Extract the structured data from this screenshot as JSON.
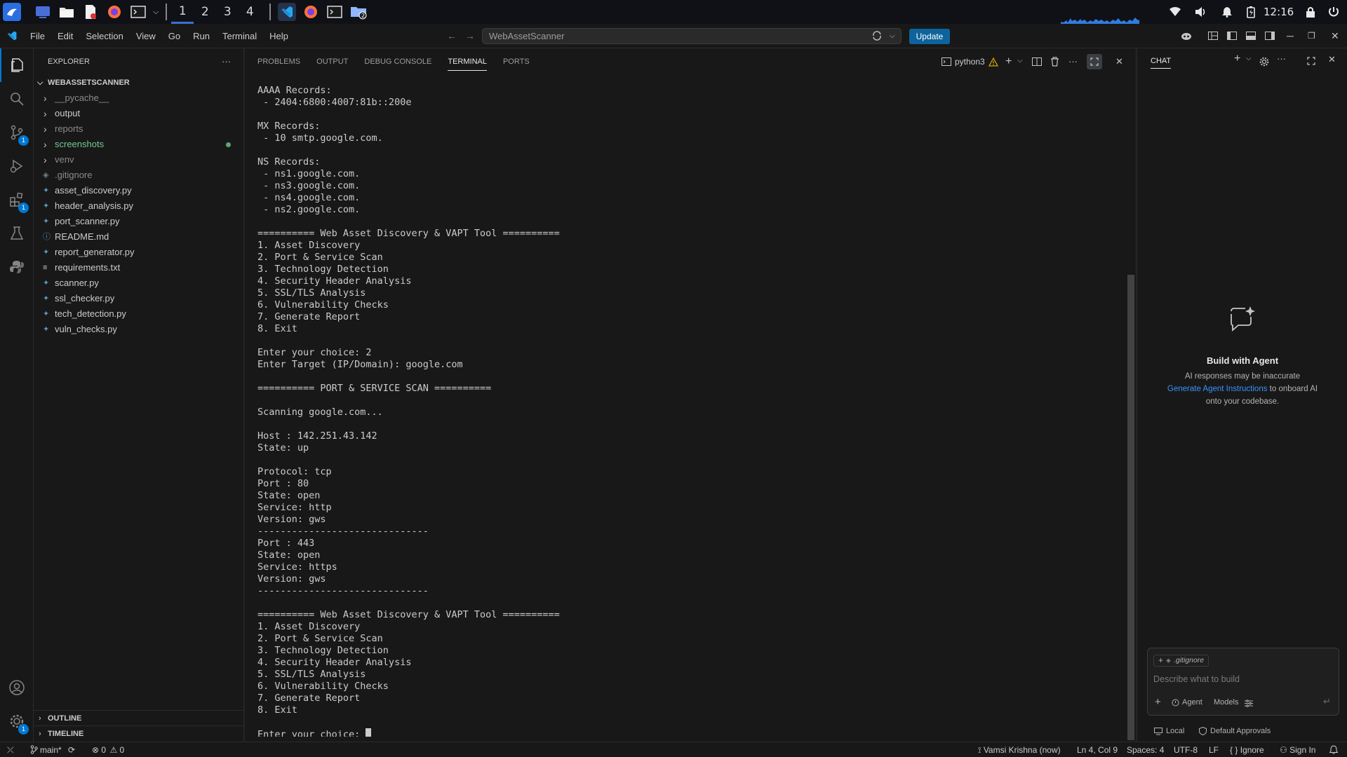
{
  "taskbar": {
    "workspaces": [
      "1",
      "2",
      "3",
      "4"
    ],
    "active_workspace": "1",
    "clock": "12:16"
  },
  "menu": [
    "File",
    "Edit",
    "Selection",
    "View",
    "Go",
    "Run",
    "Terminal",
    "Help"
  ],
  "command_center": "WebAssetScanner",
  "update_label": "Update",
  "explorer": {
    "title": "EXPLORER",
    "root": "WEBASSETSCANNER",
    "items": [
      {
        "name": "__pycache__",
        "type": "folder",
        "color": "#8b8b8b"
      },
      {
        "name": "output",
        "type": "folder",
        "color": "#cccccc"
      },
      {
        "name": "reports",
        "type": "folder",
        "color": "#8b8b8b"
      },
      {
        "name": "screenshots",
        "type": "folder",
        "color": "#73c991",
        "dot": true
      },
      {
        "name": "venv",
        "type": "folder",
        "color": "#8b8b8b"
      },
      {
        "name": ".gitignore",
        "type": "gitignore",
        "color": "#8b8b8b"
      },
      {
        "name": "asset_discovery.py",
        "type": "py",
        "color": "#cccccc"
      },
      {
        "name": "header_analysis.py",
        "type": "py",
        "color": "#cccccc"
      },
      {
        "name": "port_scanner.py",
        "type": "py",
        "color": "#cccccc"
      },
      {
        "name": "README.md",
        "type": "md",
        "color": "#cccccc"
      },
      {
        "name": "report_generator.py",
        "type": "py",
        "color": "#cccccc"
      },
      {
        "name": "requirements.txt",
        "type": "txt",
        "color": "#cccccc"
      },
      {
        "name": "scanner.py",
        "type": "py",
        "color": "#cccccc"
      },
      {
        "name": "ssl_checker.py",
        "type": "py",
        "color": "#cccccc"
      },
      {
        "name": "tech_detection.py",
        "type": "py",
        "color": "#cccccc"
      },
      {
        "name": "vuln_checks.py",
        "type": "py",
        "color": "#cccccc"
      }
    ],
    "outline": "OUTLINE",
    "timeline": "TIMELINE"
  },
  "panel": {
    "tabs": [
      "PROBLEMS",
      "OUTPUT",
      "DEBUG CONSOLE",
      "TERMINAL",
      "PORTS"
    ],
    "active_tab": "TERMINAL",
    "terminal_name": "python3"
  },
  "terminal_lines": [
    "AAAA Records:",
    " - 2404:6800:4007:81b::200e",
    "",
    "MX Records:",
    " - 10 smtp.google.com.",
    "",
    "NS Records:",
    " - ns1.google.com.",
    " - ns3.google.com.",
    " - ns4.google.com.",
    " - ns2.google.com.",
    "",
    "========== Web Asset Discovery & VAPT Tool ==========",
    "1. Asset Discovery",
    "2. Port & Service Scan",
    "3. Technology Detection",
    "4. Security Header Analysis",
    "5. SSL/TLS Analysis",
    "6. Vulnerability Checks",
    "7. Generate Report",
    "8. Exit",
    "",
    "Enter your choice: 2",
    "Enter Target (IP/Domain): google.com",
    "",
    "========== PORT & SERVICE SCAN ==========",
    "",
    "Scanning google.com...",
    "",
    "Host : 142.251.43.142",
    "State: up",
    "",
    "Protocol: tcp",
    "Port : 80",
    "State: open",
    "Service: http",
    "Version: gws",
    "------------------------------",
    "Port : 443",
    "State: open",
    "Service: https",
    "Version: gws",
    "------------------------------",
    "",
    "========== Web Asset Discovery & VAPT Tool ==========",
    "1. Asset Discovery",
    "2. Port & Service Scan",
    "3. Technology Detection",
    "4. Security Header Analysis",
    "5. SSL/TLS Analysis",
    "6. Vulnerability Checks",
    "7. Generate Report",
    "8. Exit",
    "",
    "Enter your choice: "
  ],
  "chat": {
    "title": "CHAT",
    "heading": "Build with Agent",
    "disclaimer": "AI responses may be inaccurate",
    "link": "Generate Agent Instructions",
    "link_suffix": " to onboard AI",
    "line3": "onto your codebase.",
    "context_file": ".gitignore",
    "placeholder": "Describe what to build",
    "mode": "Agent",
    "models": "Models",
    "local": "Local",
    "approvals": "Default Approvals"
  },
  "status": {
    "branch": "main*",
    "errors": "0",
    "warnings": "0",
    "author": "Vamsi Krishna (now)",
    "position": "Ln 4, Col 9",
    "spaces": "Spaces: 4",
    "encoding": "UTF-8",
    "eol": "LF",
    "language": "Ignore",
    "signin": "Sign In"
  },
  "colors": {
    "accent": "#0078d4",
    "link": "#3794ff",
    "git_added": "#73c991",
    "python_icon": "#519aba"
  }
}
